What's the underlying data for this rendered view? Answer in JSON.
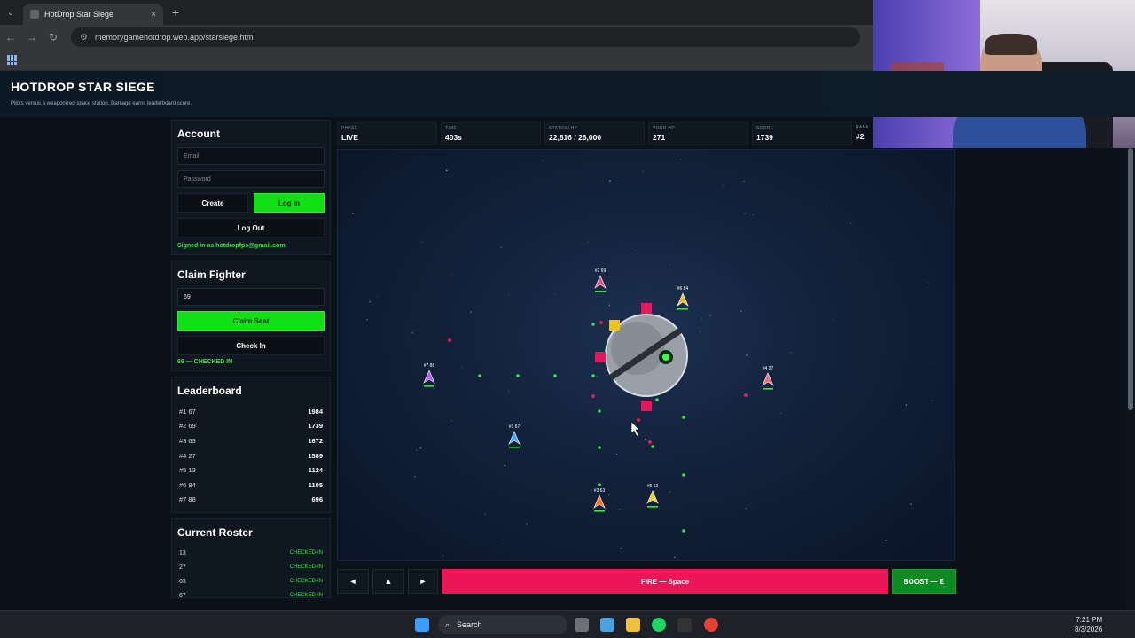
{
  "browser": {
    "tab_title": "HotDrop Star Siege",
    "tab_close": "×",
    "new_tab": "+",
    "url": "memorygamehotdrop.web.app/starsiege.html"
  },
  "page": {
    "title": "HOTDROP STAR SIEGE",
    "subtitle": "Pilots versus a weaponized space station. Damage earns leaderboard score."
  },
  "account": {
    "heading": "Account",
    "email_placeholder": "Email",
    "password_placeholder": "Password",
    "create_label": "Create",
    "login_label": "Log In",
    "logout_label": "Log Out",
    "signed_in_text": "Signed in as hotdropfps@gmail.com"
  },
  "claim": {
    "heading": "Claim Fighter",
    "seat_value": "69",
    "claim_label": "Claim Seat",
    "checkin_label": "Check In",
    "status": "69 — CHECKED IN"
  },
  "leaderboard": {
    "heading": "Leaderboard",
    "rows": [
      {
        "name": "#1 67",
        "score": "1984"
      },
      {
        "name": "#2 69",
        "score": "1739"
      },
      {
        "name": "#3 63",
        "score": "1672"
      },
      {
        "name": "#4 27",
        "score": "1589"
      },
      {
        "name": "#5 13",
        "score": "1124"
      },
      {
        "name": "#6 84",
        "score": "1105"
      },
      {
        "name": "#7 88",
        "score": "696"
      }
    ]
  },
  "roster": {
    "heading": "Current Roster",
    "rows": [
      {
        "id": "13",
        "status": "CHECKED-IN"
      },
      {
        "id": "27",
        "status": "CHECKED-IN"
      },
      {
        "id": "63",
        "status": "CHECKED-IN"
      },
      {
        "id": "67",
        "status": "CHECKED-IN"
      }
    ]
  },
  "stats": [
    {
      "label": "PHASE",
      "value": "LIVE"
    },
    {
      "label": "TIME",
      "value": "403s"
    },
    {
      "label": "STATION HP",
      "value": "22,816 / 26,000"
    },
    {
      "label": "YOUR HP",
      "value": "271"
    },
    {
      "label": "SCORE",
      "value": "1739"
    },
    {
      "label": "RANK",
      "value": "#2"
    }
  ],
  "ships": [
    {
      "label": "#2 69",
      "color": "#e0508a"
    },
    {
      "label": "#6 84",
      "color": "#f0c020"
    },
    {
      "label": "#7 88",
      "color": "#b060f0"
    },
    {
      "label": "#4 27",
      "color": "#f07080"
    },
    {
      "label": "#1 67",
      "color": "#40a8ff"
    },
    {
      "label": "#3 63",
      "color": "#ff7020"
    },
    {
      "label": "#5 13",
      "color": "#f0d020"
    }
  ],
  "controls": {
    "left": "◄",
    "up": "▲",
    "right": "►",
    "fire": "FIRE — Space",
    "boost": "BOOST — E"
  },
  "taskbar": {
    "search": "Search",
    "time": "7:21 PM",
    "date": "8/3/2026"
  }
}
